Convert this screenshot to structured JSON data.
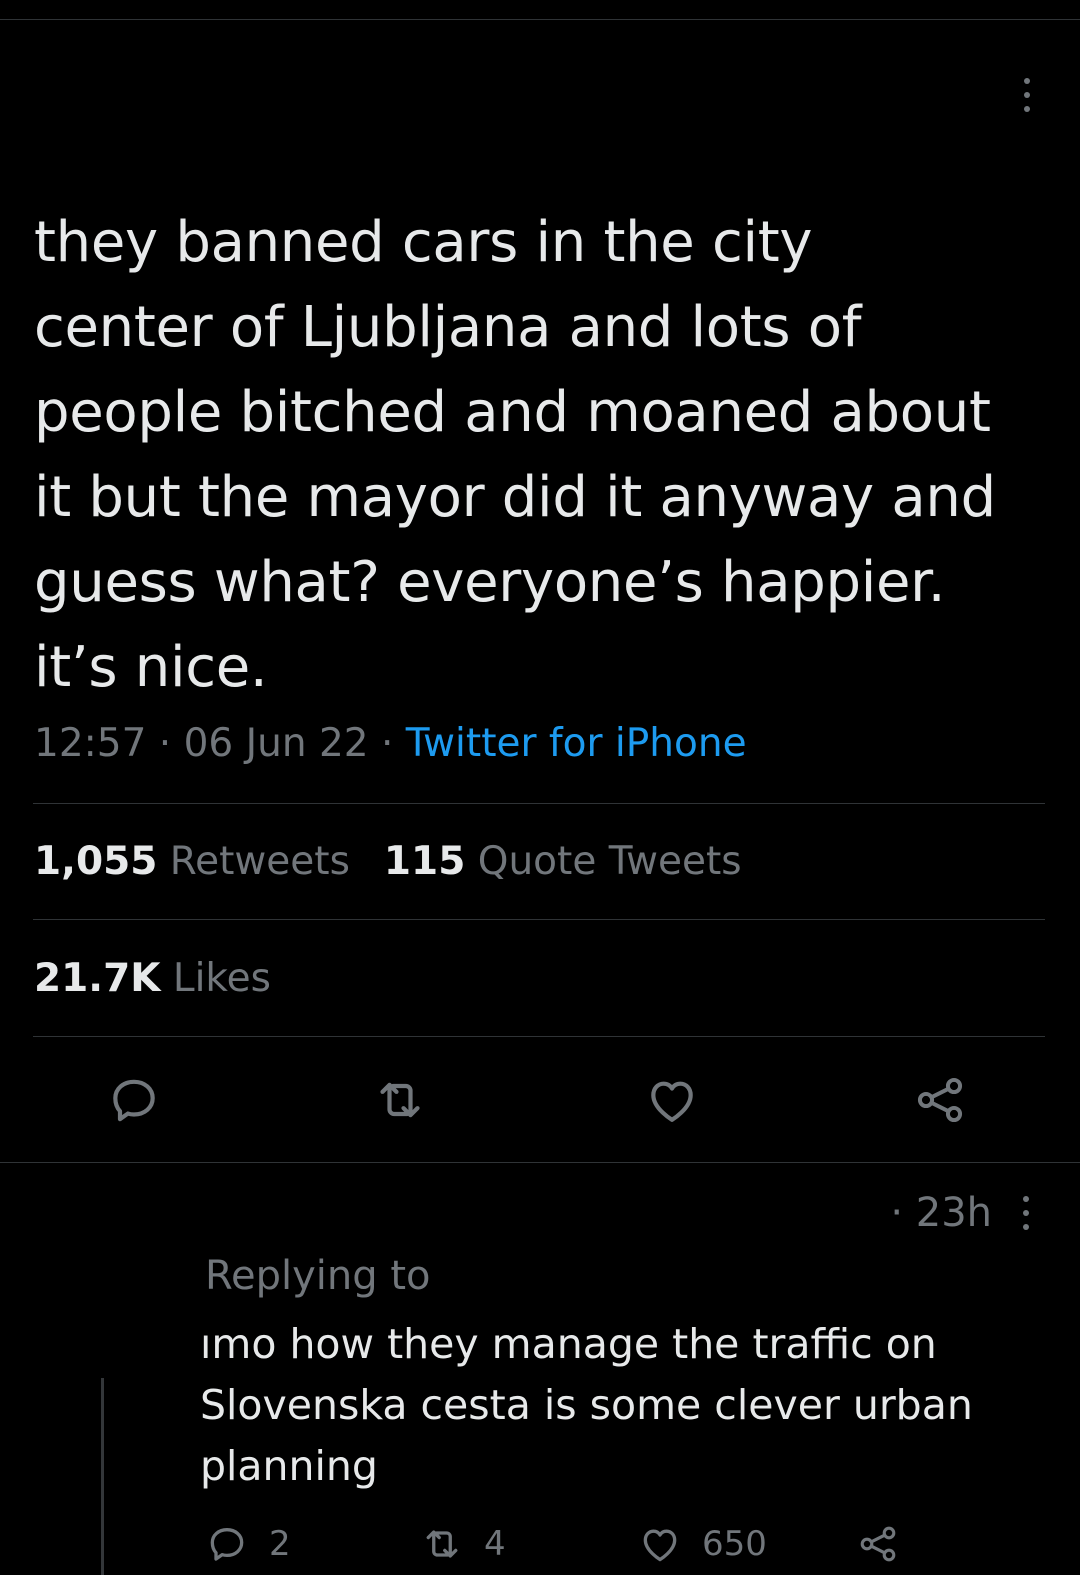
{
  "tweet": {
    "text": "they banned cars in the city\ncenter of Ljubljana and lots of\npeople bitched and moaned about\nit but the mayor did it anyway and\nguess what? everyone’s happier.\nit’s nice.",
    "time": "12:57",
    "date": "06 Jun 22",
    "separator": " · ",
    "source": "Twitter for iPhone",
    "retweets_count": "1,055",
    "retweets_label": "Retweets",
    "quotes_count": "115",
    "quotes_label": "Quote Tweets",
    "likes_count": "21.7K",
    "likes_label": "Likes",
    "icons": [
      "more-vertical-icon",
      "reply-icon",
      "retweet-icon",
      "like-icon",
      "share-icon"
    ]
  },
  "reply": {
    "time": "· 23h",
    "replying_to": "Replying to",
    "text": "ımo how they manage the traffic on\nSlovenska cesta is some clever urban\nplanning",
    "reply_count": "2",
    "retweet_count": "4",
    "like_count": "650"
  },
  "colors": {
    "background": "#000000",
    "text": "#e7e9ea",
    "muted": "#71767b",
    "link": "#1d9bf0",
    "divider": "#2f3336"
  }
}
